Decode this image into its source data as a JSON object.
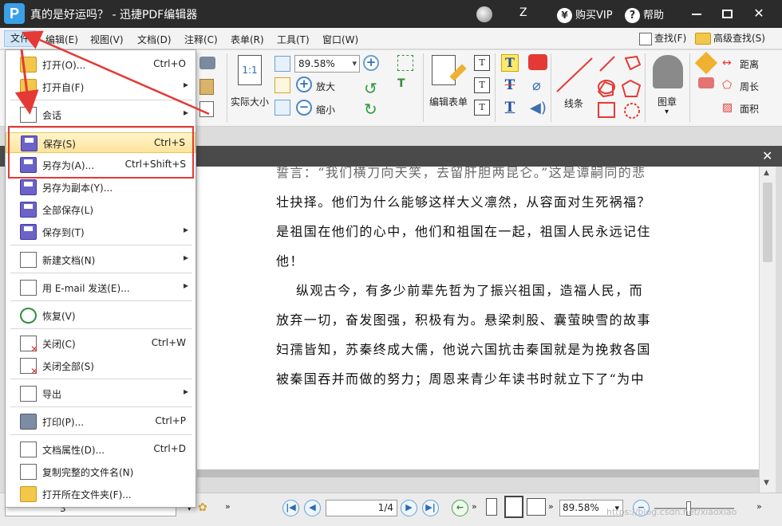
{
  "titlebar": {
    "app_title": "真的是好运吗？ - 迅捷PDF编辑器",
    "user_initial": "Z",
    "buy_vip": "购买VIP",
    "help": "帮助"
  },
  "menubar": {
    "items": [
      "文件",
      "编辑(E)",
      "视图(V)",
      "文档(D)",
      "注释(C)",
      "表单(R)",
      "工具(T)",
      "窗口(W)"
    ],
    "find": "查找(F)",
    "advanced_find": "高级查找(S)"
  },
  "ribbon": {
    "zoom_value": "89.58%",
    "actual_size": "实际大小",
    "actual_size_icon": "1:1",
    "zoom_in": "放大",
    "zoom_out": "缩小",
    "edit_form": "编辑表单",
    "line": "线条",
    "stamp": "图章",
    "distance": "距离",
    "perimeter": "周长",
    "area": "面积"
  },
  "file_menu": {
    "items": [
      {
        "label": "打开(O)...",
        "shortcut": "Ctrl+O",
        "icon": "open-folder-icon"
      },
      {
        "label": "打开自(F)",
        "submenu": true,
        "icon": "open-from-icon"
      },
      {
        "label": "会话",
        "submenu": true,
        "icon": "session-icon"
      },
      {
        "label": "保存(S)",
        "shortcut": "Ctrl+S",
        "icon": "save-disk-icon",
        "highlighted": true
      },
      {
        "label": "另存为(A)...",
        "shortcut": "Ctrl+Shift+S",
        "icon": "save-as-icon"
      },
      {
        "label": "另存为副本(Y)...",
        "icon": "save-copy-icon"
      },
      {
        "label": "全部保存(L)",
        "icon": "save-all-icon"
      },
      {
        "label": "保存到(T)",
        "submenu": true,
        "icon": "save-to-icon"
      },
      {
        "label": "新建文档(N)",
        "submenu": true,
        "icon": "new-document-icon"
      },
      {
        "label": "用 E-mail 发送(E)...",
        "submenu": true,
        "icon": "email-icon"
      },
      {
        "label": "恢复(V)",
        "icon": "revert-icon"
      },
      {
        "label": "关闭(C)",
        "shortcut": "Ctrl+W",
        "icon": "close-doc-icon"
      },
      {
        "label": "关闭全部(S)",
        "icon": "close-all-icon"
      },
      {
        "label": "导出",
        "submenu": true,
        "icon": "export-icon"
      },
      {
        "label": "打印(P)...",
        "shortcut": "Ctrl+P",
        "icon": "printer-icon"
      },
      {
        "label": "文档属性(D)...",
        "shortcut": "Ctrl+D",
        "icon": "doc-properties-icon"
      },
      {
        "label": "复制完整的文件名(N)",
        "icon": "copy-filename-icon"
      },
      {
        "label": "打开所在文件夹(F)...",
        "icon": "open-containing-folder-icon"
      }
    ]
  },
  "document": {
    "lines": [
      "誓言：“我们横刀向天笑，去留肝胆两昆仑。”这是谭嗣同的悲",
      "壮抉择。他们为什么能够这样大义凛然，从容面对生死祸福？",
      "是祖国在他们的心中，他们和祖国在一起，祖国人民永远记住",
      "他！",
      "纵观古今，有多少前辈先哲为了振兴祖国，造福人民，而",
      "放弃一切，奋发图强，积极有为。悬梁刺股、囊萤映雪的故事",
      "妇孺皆知，苏秦终成大儒，他说六国抗击秦国就是为挽救各国",
      "被秦国吞并而做的努力；周恩来青少年读书时就立下了“为中"
    ]
  },
  "statusbar": {
    "page_display": "1/4",
    "zoom_value": "89.58%",
    "left_panel_value": "3",
    "watermark": "https://blog.csdn.net/xiaoxiao"
  }
}
